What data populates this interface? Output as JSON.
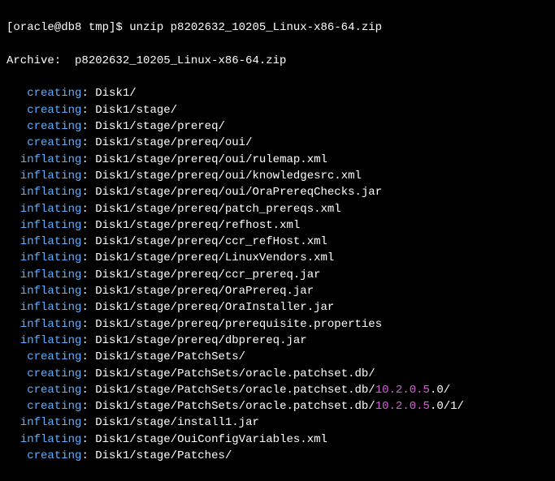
{
  "prompt": {
    "user_host": "[oracle@db8 tmp]$ ",
    "command": "unzip p8202632_10205_Linux-x86-64.zip"
  },
  "archive_line": {
    "label": "Archive:  ",
    "file": "p8202632_10205_Linux-x86-64.zip"
  },
  "lines": [
    {
      "indent": "   ",
      "action": "creating",
      "sep": ": ",
      "path": "Disk1/",
      "version_part": "",
      "suffix": ""
    },
    {
      "indent": "   ",
      "action": "creating",
      "sep": ": ",
      "path": "Disk1/stage/",
      "version_part": "",
      "suffix": ""
    },
    {
      "indent": "   ",
      "action": "creating",
      "sep": ": ",
      "path": "Disk1/stage/prereq/",
      "version_part": "",
      "suffix": ""
    },
    {
      "indent": "   ",
      "action": "creating",
      "sep": ": ",
      "path": "Disk1/stage/prereq/oui/",
      "version_part": "",
      "suffix": ""
    },
    {
      "indent": "  ",
      "action": "inflating",
      "sep": ": ",
      "path": "Disk1/stage/prereq/oui/rulemap.xml",
      "version_part": "",
      "suffix": ""
    },
    {
      "indent": "  ",
      "action": "inflating",
      "sep": ": ",
      "path": "Disk1/stage/prereq/oui/knowledgesrc.xml",
      "version_part": "",
      "suffix": ""
    },
    {
      "indent": "  ",
      "action": "inflating",
      "sep": ": ",
      "path": "Disk1/stage/prereq/oui/OraPrereqChecks.jar",
      "version_part": "",
      "suffix": ""
    },
    {
      "indent": "  ",
      "action": "inflating",
      "sep": ": ",
      "path": "Disk1/stage/prereq/patch_prereqs.xml",
      "version_part": "",
      "suffix": ""
    },
    {
      "indent": "  ",
      "action": "inflating",
      "sep": ": ",
      "path": "Disk1/stage/prereq/refhost.xml",
      "version_part": "",
      "suffix": ""
    },
    {
      "indent": "  ",
      "action": "inflating",
      "sep": ": ",
      "path": "Disk1/stage/prereq/ccr_refHost.xml",
      "version_part": "",
      "suffix": ""
    },
    {
      "indent": "  ",
      "action": "inflating",
      "sep": ": ",
      "path": "Disk1/stage/prereq/LinuxVendors.xml",
      "version_part": "",
      "suffix": ""
    },
    {
      "indent": "  ",
      "action": "inflating",
      "sep": ": ",
      "path": "Disk1/stage/prereq/ccr_prereq.jar",
      "version_part": "",
      "suffix": ""
    },
    {
      "indent": "  ",
      "action": "inflating",
      "sep": ": ",
      "path": "Disk1/stage/prereq/OraPrereq.jar",
      "version_part": "",
      "suffix": ""
    },
    {
      "indent": "  ",
      "action": "inflating",
      "sep": ": ",
      "path": "Disk1/stage/prereq/OraInstaller.jar",
      "version_part": "",
      "suffix": ""
    },
    {
      "indent": "  ",
      "action": "inflating",
      "sep": ": ",
      "path": "Disk1/stage/prereq/prerequisite.properties",
      "version_part": "",
      "suffix": ""
    },
    {
      "indent": "  ",
      "action": "inflating",
      "sep": ": ",
      "path": "Disk1/stage/prereq/dbprereq.jar",
      "version_part": "",
      "suffix": ""
    },
    {
      "indent": "   ",
      "action": "creating",
      "sep": ": ",
      "path": "Disk1/stage/PatchSets/",
      "version_part": "",
      "suffix": ""
    },
    {
      "indent": "   ",
      "action": "creating",
      "sep": ": ",
      "path": "Disk1/stage/PatchSets/oracle.patchset.db/",
      "version_part": "",
      "suffix": ""
    },
    {
      "indent": "   ",
      "action": "creating",
      "sep": ": ",
      "path": "Disk1/stage/PatchSets/oracle.patchset.db/",
      "version_part": "10.2.0.5",
      "suffix": ".0/"
    },
    {
      "indent": "   ",
      "action": "creating",
      "sep": ": ",
      "path": "Disk1/stage/PatchSets/oracle.patchset.db/",
      "version_part": "10.2.0.5",
      "suffix": ".0/1/"
    },
    {
      "indent": "  ",
      "action": "inflating",
      "sep": ": ",
      "path": "Disk1/stage/install1.jar",
      "version_part": "",
      "suffix": ""
    },
    {
      "indent": "  ",
      "action": "inflating",
      "sep": ": ",
      "path": "Disk1/stage/OuiConfigVariables.xml",
      "version_part": "",
      "suffix": ""
    },
    {
      "indent": "   ",
      "action": "creating",
      "sep": ": ",
      "path": "Disk1/stage/Patches/",
      "version_part": "",
      "suffix": ""
    }
  ]
}
